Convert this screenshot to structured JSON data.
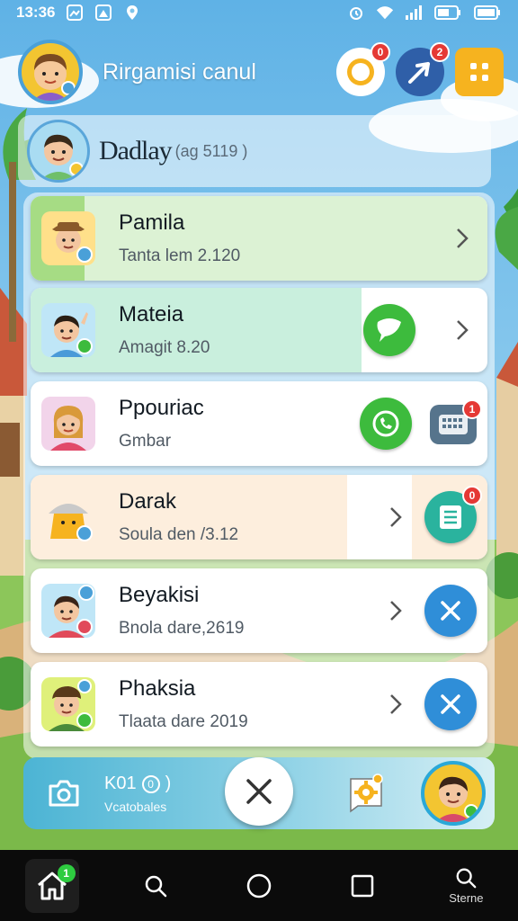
{
  "status_bar": {
    "time": "13:36"
  },
  "header": {
    "title": "Rirgamisi canul",
    "badge_1": "0",
    "badge_2": "2"
  },
  "profile": {
    "name": "Dadlay",
    "sub": "(ag 5119 )"
  },
  "chats": [
    {
      "name": "Pamila",
      "sub": "Tanta lem 2.120",
      "bg": "#d9f3d2"
    },
    {
      "name": "Mateia",
      "sub": "Amagit 8.20",
      "bg": "#cdeedd"
    },
    {
      "name": "Ppouriac",
      "sub": "Gmbar",
      "bg": "#ffffff",
      "action_badge": "1"
    },
    {
      "name": "Darak",
      "sub": "Soula den /3.12",
      "bg": "#fdeedd",
      "action_badge": "0"
    },
    {
      "name": "Beyakisi",
      "sub": "Bnola dare,2619",
      "bg": "#ffffff"
    },
    {
      "name": "Phaksia",
      "sub": "Tlaata dare 2019",
      "bg": "#ffffff"
    }
  ],
  "bottom_card": {
    "count": "K01",
    "count_badge": "0",
    "label": "Vcatobales"
  },
  "nav": {
    "home_badge": "1",
    "search_label": "Sterne"
  },
  "colors": {
    "sky": "#7ec4ea",
    "accent_blue": "#2f8ed8",
    "green_action": "#3dbb3d",
    "teal_action": "#2ab39e",
    "orange_button": "#f6b31f",
    "badge_red": "#e53935"
  }
}
